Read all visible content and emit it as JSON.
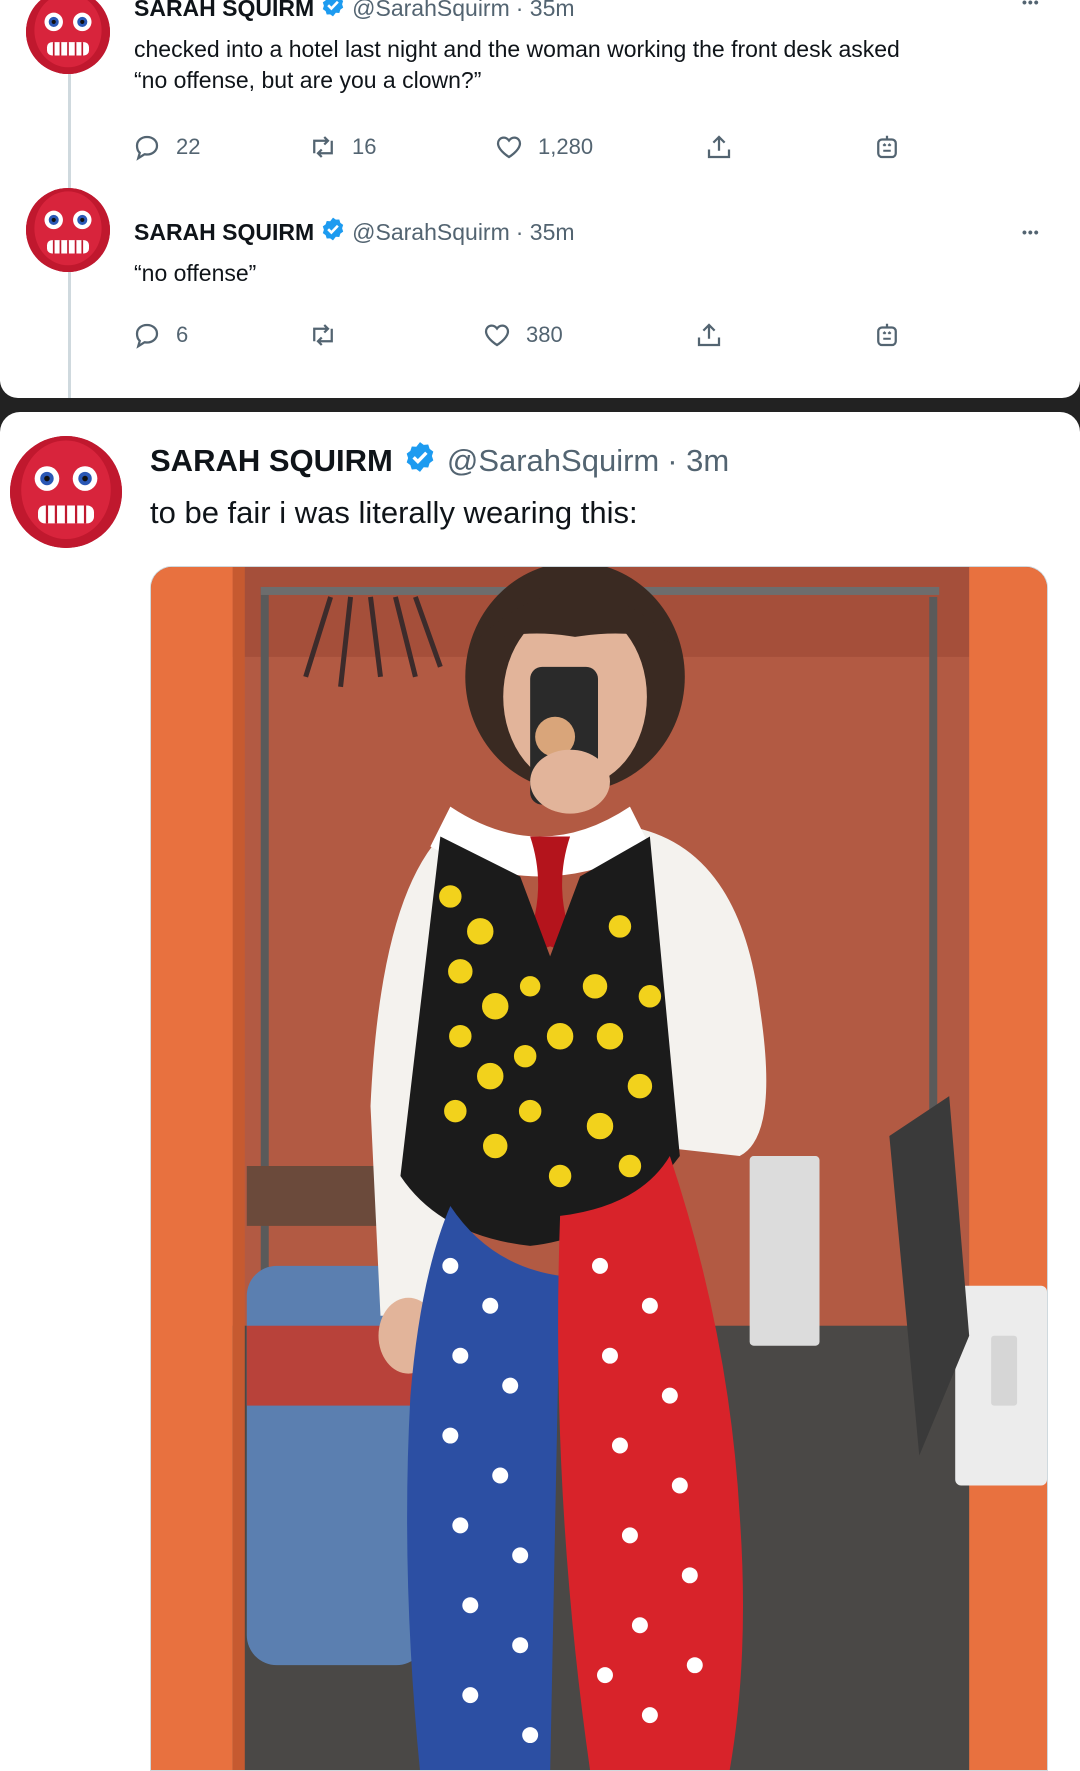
{
  "tweets": [
    {
      "name": "SARAH SQUIRM",
      "handle": "@SarahSquirm",
      "time": "· 35m",
      "text_line1": "checked into a hotel last night and the woman working the front desk asked",
      "text_line2": "“no offense, but are you a clown?”",
      "replies": "22",
      "retweets": "16",
      "likes": "1,280",
      "more": "•••"
    },
    {
      "name": "SARAH SQUIRM",
      "handle": "@SarahSquirm",
      "time": "· 35m",
      "text_line1": "“no offense”",
      "replies": "6",
      "retweets": "",
      "likes": "380",
      "more": "•••"
    },
    {
      "name": "SARAH SQUIRM",
      "handle": "@SarahSquirm",
      "time": "· 3m",
      "text_line1": "to be fair i was literally wearing this:"
    }
  ],
  "icons": {
    "reply": "reply-icon",
    "retweet": "retweet-icon",
    "like": "heart-icon",
    "share": "share-icon",
    "bot": "bot-icon",
    "verified": "verified-badge-icon"
  },
  "colors": {
    "verified": "#1d9bf0",
    "secondary_text": "#536471",
    "divider": "#222222",
    "wall": "#b5553c",
    "door_frame": "#e8713f"
  }
}
